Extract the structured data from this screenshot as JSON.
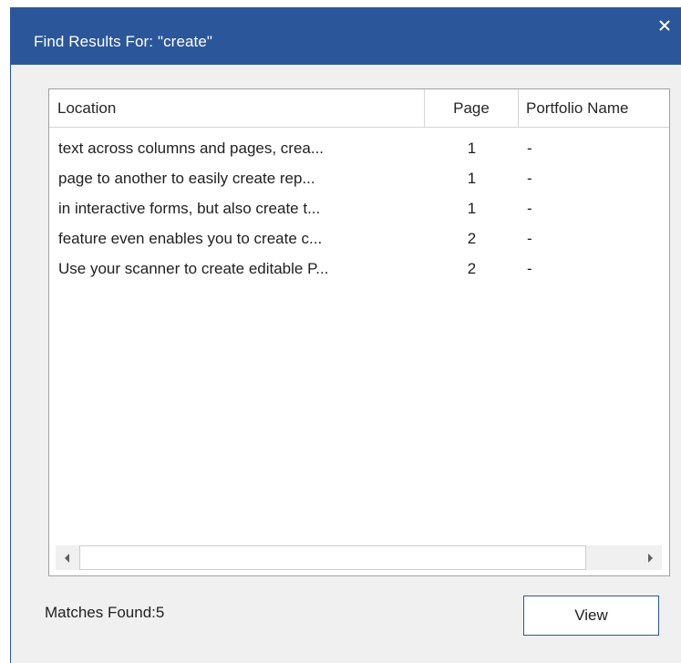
{
  "dialog": {
    "title": "Find Results For: \"create\"",
    "close_icon": "close-icon",
    "accent_color": "#2b579a"
  },
  "results": {
    "columns": {
      "location": "Location",
      "page": "Page",
      "portfolio": "Portfolio Name"
    },
    "rows": [
      {
        "location": " text across columns and pages, crea...",
        "page": "1",
        "portfolio": "-"
      },
      {
        "location": " page to another to easily create rep...",
        "page": "1",
        "portfolio": "-"
      },
      {
        "location": " in interactive forms, but also create t...",
        "page": "1",
        "portfolio": "-"
      },
      {
        "location": " feature even enables you to create c...",
        "page": "2",
        "portfolio": "-"
      },
      {
        "location": "Use your scanner to create editable P...",
        "page": "2",
        "portfolio": "-"
      }
    ],
    "scroll_left_icon": "triangle-left-icon",
    "scroll_right_icon": "triangle-right-icon"
  },
  "footer": {
    "matches_text": "Matches Found:5",
    "view_label": "View"
  }
}
